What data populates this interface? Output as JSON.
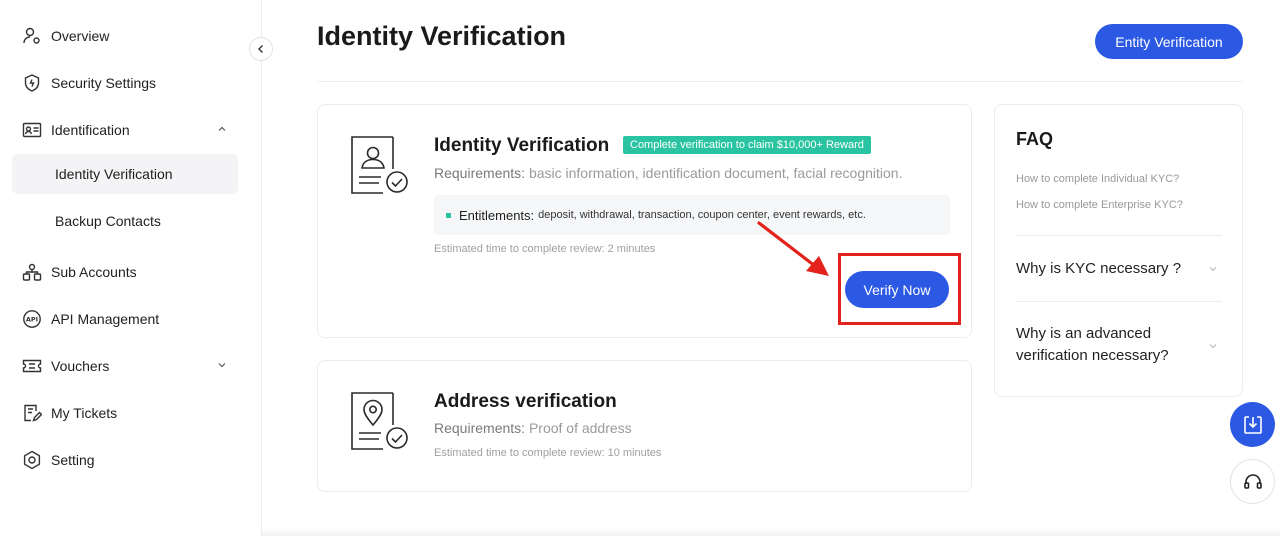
{
  "sidebar": {
    "items": [
      {
        "label": "Overview",
        "icon": "user-icon"
      },
      {
        "label": "Security Settings",
        "icon": "shield-icon"
      },
      {
        "label": "Identification",
        "icon": "id-card-icon"
      },
      {
        "label": "Identity Verification"
      },
      {
        "label": "Backup Contacts"
      },
      {
        "label": "Sub Accounts",
        "icon": "sub-accounts-icon"
      },
      {
        "label": "API Management",
        "icon": "api-icon"
      },
      {
        "label": "Vouchers",
        "icon": "voucher-icon"
      },
      {
        "label": "My Tickets",
        "icon": "ticket-icon"
      },
      {
        "label": "Setting",
        "icon": "gear-icon"
      }
    ]
  },
  "header": {
    "title": "Identity Verification",
    "entity_button": "Entity Verification"
  },
  "kyc_card": {
    "title": "Identity Verification",
    "badge": "Complete verification to claim $10,000+ Reward",
    "requirements_label": "Requirements:",
    "requirements_value": "basic information, identification document, facial recognition.",
    "entitlements_label": "Entitlements:",
    "entitlements_value": "deposit, withdrawal, transaction, coupon center, event rewards, etc.",
    "estimate": "Estimated time to complete review: 2 minutes",
    "verify_button": "Verify Now"
  },
  "address_card": {
    "title": "Address verification",
    "requirements_label": "Requirements:",
    "requirements_value": "Proof of address",
    "estimate": "Estimated time to complete review: 10 minutes"
  },
  "faq": {
    "title": "FAQ",
    "links": [
      "How to complete Individual KYC?",
      "How to complete Enterprise KYC?"
    ],
    "questions": [
      "Why is KYC necessary ?",
      "Why is an advanced verification necessary?"
    ]
  },
  "colors": {
    "accent": "#2b59e3",
    "badge": "#2bc4a2",
    "highlight": "#e3221c"
  }
}
